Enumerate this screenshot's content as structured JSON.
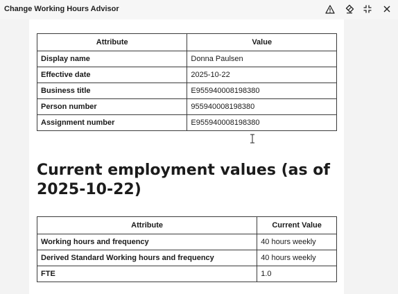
{
  "window": {
    "title": "Change Working Hours Advisor",
    "icons": [
      "warning-icon",
      "eraser-icon",
      "collapse-icon",
      "close-icon"
    ]
  },
  "summary_table": {
    "headers": [
      "Attribute",
      "Value"
    ],
    "rows": [
      {
        "attribute": "Display name",
        "value": "Donna Paulsen"
      },
      {
        "attribute": "Effective date",
        "value": "2025-10-22"
      },
      {
        "attribute": "Business title",
        "value": "E955940008198380"
      },
      {
        "attribute": "Person number",
        "value": "955940008198380"
      },
      {
        "attribute": "Assignment number",
        "value": "E955940008198380"
      }
    ]
  },
  "employment_section": {
    "heading": "Current employment values (as of 2025-10-22)",
    "headers": [
      "Attribute",
      "Current Value"
    ],
    "rows": [
      {
        "attribute": "Working hours and frequency",
        "value": "40 hours weekly"
      },
      {
        "attribute": "Derived Standard Working hours and frequency",
        "value": "40 hours weekly"
      },
      {
        "attribute": "FTE",
        "value": "1.0"
      }
    ]
  }
}
